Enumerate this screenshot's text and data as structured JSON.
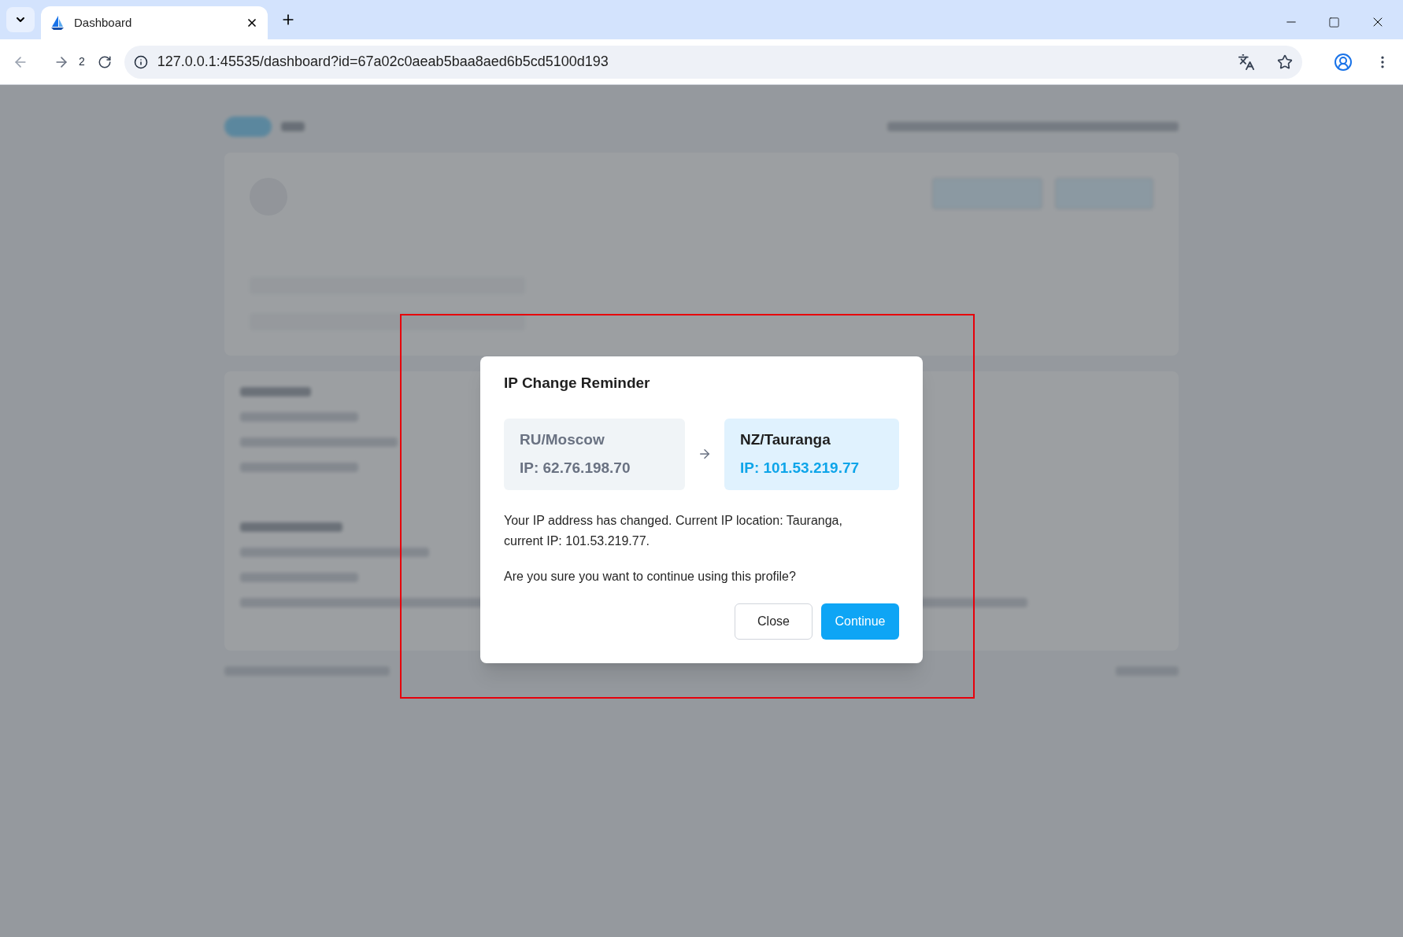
{
  "browser": {
    "tab": {
      "title": "Dashboard",
      "selected": true
    },
    "history_count": "2",
    "address": "127.0.0.1:45535/dashboard?id=67a02c0aeab5baa8aed6b5cd5100d193"
  },
  "dialog": {
    "title": "IP Change Reminder",
    "from": {
      "location": "RU/Moscow",
      "ip": "IP: 62.76.198.70"
    },
    "to": {
      "location": "NZ/Tauranga",
      "ip": "IP: 101.53.219.77"
    },
    "message": "Your IP address has changed. Current IP location: Tauranga, current IP: 101.53.219.77.",
    "question": "Are you sure you want to continue using this profile?",
    "buttons": [
      {
        "label": "Close",
        "kind": "secondary"
      },
      {
        "label": "Continue",
        "kind": "primary"
      }
    ]
  }
}
